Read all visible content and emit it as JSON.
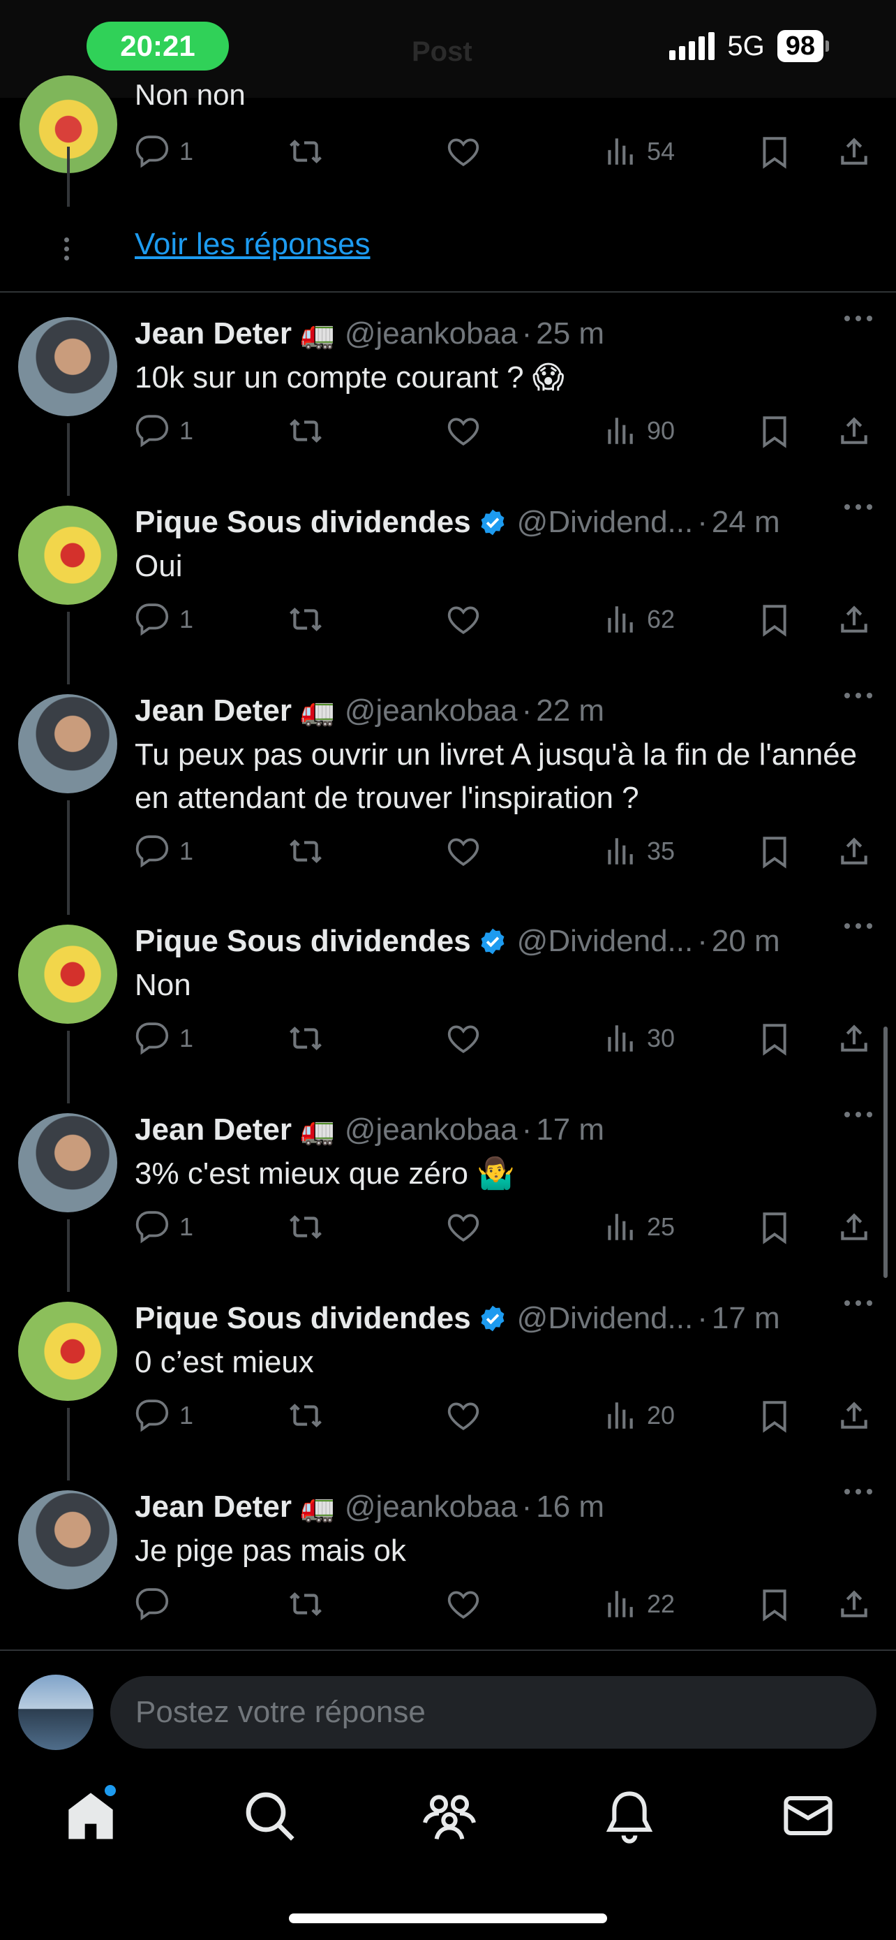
{
  "status_bar": {
    "time": "20:21",
    "network": "5G",
    "battery": "98"
  },
  "header_faded_title": "Post",
  "previous_reply": {
    "text": "Non non",
    "replies": "1",
    "views": "54"
  },
  "more_replies_label": "Voir les réponses",
  "tweets": [
    {
      "name": "Jean Deter",
      "emoji": "🚛",
      "verified": false,
      "handle": "@jeankobaa",
      "age": "25 m",
      "text": "10k sur un compte courant ? 😱",
      "replies": "1",
      "views": "90",
      "avatar": "jean"
    },
    {
      "name": "Pique Sous dividendes",
      "emoji": "",
      "verified": true,
      "handle": "@Dividend...",
      "age": "24 m",
      "text": "Oui",
      "replies": "1",
      "views": "62",
      "avatar": "pique"
    },
    {
      "name": "Jean Deter",
      "emoji": "🚛",
      "verified": false,
      "handle": "@jeankobaa",
      "age": "22 m",
      "text": "Tu peux pas ouvrir un livret A jusqu'à la fin de l'année en attendant de trouver l'inspiration ?",
      "replies": "1",
      "views": "35",
      "avatar": "jean"
    },
    {
      "name": "Pique Sous dividendes",
      "emoji": "",
      "verified": true,
      "handle": "@Dividend...",
      "age": "20 m",
      "text": "Non",
      "replies": "1",
      "views": "30",
      "avatar": "pique"
    },
    {
      "name": "Jean Deter",
      "emoji": "🚛",
      "verified": false,
      "handle": "@jeankobaa",
      "age": "17 m",
      "text": "3% c'est mieux que zéro 🤷‍♂️",
      "replies": "1",
      "views": "25",
      "avatar": "jean"
    },
    {
      "name": "Pique Sous dividendes",
      "emoji": "",
      "verified": true,
      "handle": "@Dividend...",
      "age": "17 m",
      "text": "0 c’est mieux",
      "replies": "1",
      "views": "20",
      "avatar": "pique"
    },
    {
      "name": "Jean Deter",
      "emoji": "🚛",
      "verified": false,
      "handle": "@jeankobaa",
      "age": "16 m",
      "text": "Je pige pas mais ok",
      "replies": "",
      "views": "22",
      "avatar": "jean"
    }
  ],
  "reply_box": {
    "placeholder": "Postez votre réponse"
  },
  "tabs": [
    {
      "icon": "home-icon",
      "active": true,
      "badge": true
    },
    {
      "icon": "search-icon",
      "active": false
    },
    {
      "icon": "communities-icon",
      "active": false
    },
    {
      "icon": "notifications-icon",
      "active": false
    },
    {
      "icon": "messages-icon",
      "active": false
    }
  ],
  "colors": {
    "background": "#000000",
    "accent": "#1d9bf0",
    "muted": "#71767b",
    "verified": "#1d9bf0"
  }
}
